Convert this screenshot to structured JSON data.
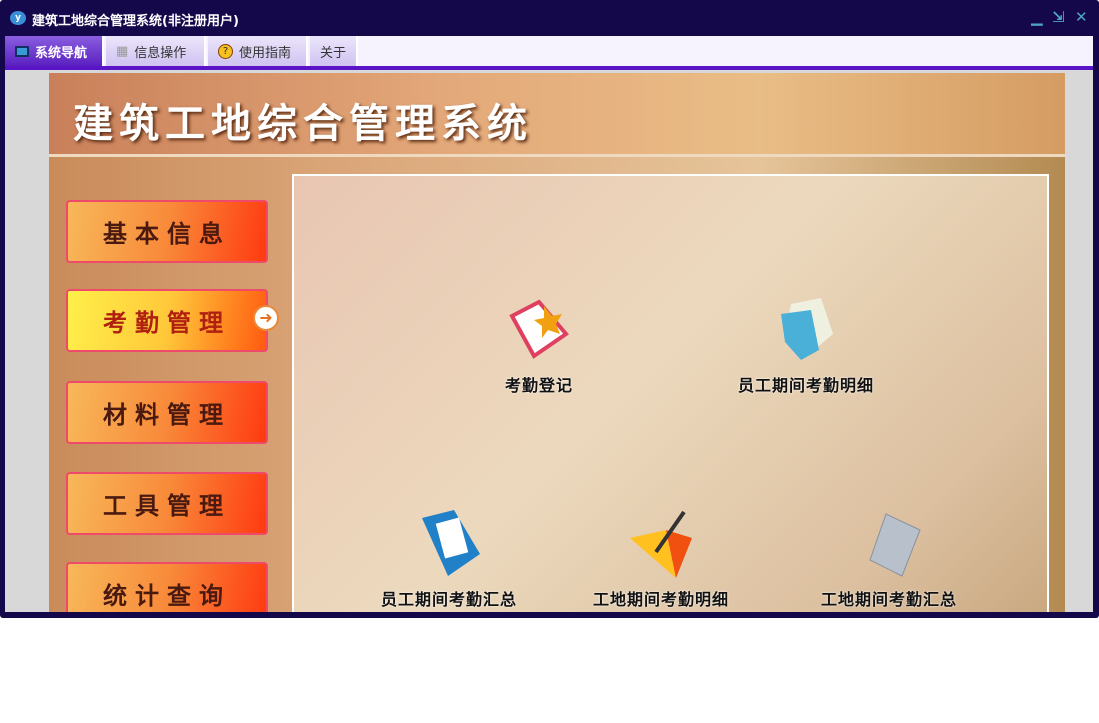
{
  "window": {
    "title": "建筑工地综合管理系统(非注册用户)",
    "logo": "y"
  },
  "tabs": [
    {
      "label": "系统导航",
      "icon": "monitor-icon"
    },
    {
      "label": "信息操作",
      "icon": "grid-icon"
    },
    {
      "label": "使用指南",
      "icon": "help-icon"
    },
    {
      "label": "关于"
    }
  ],
  "banner": {
    "title": "建筑工地综合管理系统"
  },
  "sidebar": [
    {
      "label": "基本信息"
    },
    {
      "label": "考勤管理",
      "active": true
    },
    {
      "label": "材料管理"
    },
    {
      "label": "工具管理"
    },
    {
      "label": "统计查询"
    }
  ],
  "main": {
    "items": [
      {
        "label": "考勤登记",
        "icon": "notebook-leaf-icon"
      },
      {
        "label": "员工期间考勤明细",
        "icon": "blue-folder-icon"
      },
      {
        "label": "员工期间考勤汇总",
        "icon": "blue-binder-icon"
      },
      {
        "label": "工地期间考勤明细",
        "icon": "orange-folder-pen-icon"
      },
      {
        "label": "工地期间考勤汇总",
        "icon": "grey-folder-icon"
      }
    ]
  }
}
